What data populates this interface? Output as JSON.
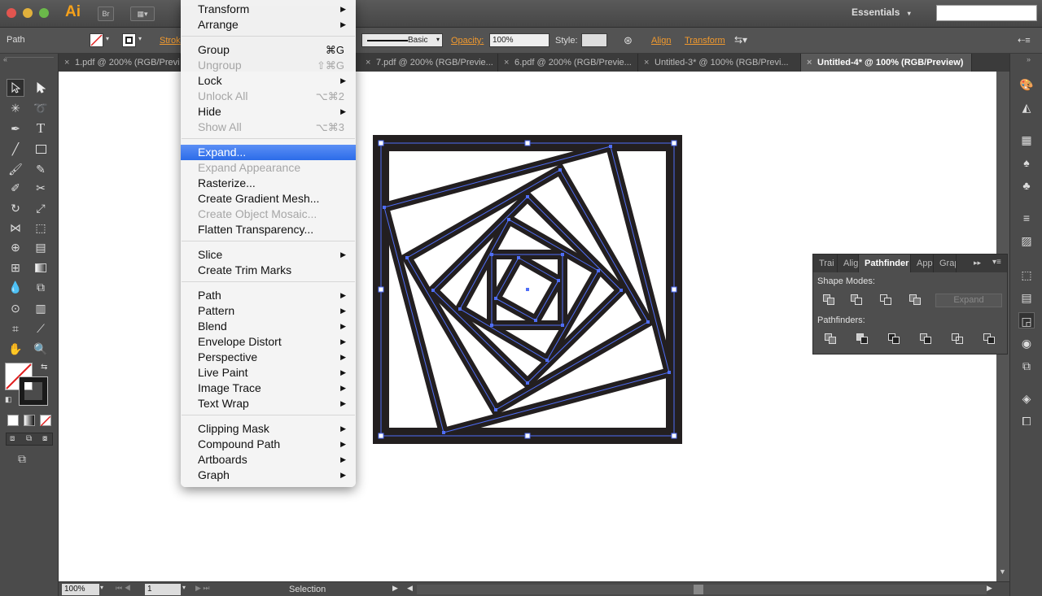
{
  "app": {
    "logo": "Ai",
    "bridge": "Br",
    "workspace": "Essentials"
  },
  "menu": {
    "items": [
      {
        "label": "Transform",
        "submenu": true
      },
      {
        "label": "Arrange",
        "submenu": true
      },
      {
        "label": "Group",
        "shortcut": "⌘G"
      },
      {
        "label": "Ungroup",
        "shortcut": "⇧⌘G",
        "disabled": true
      },
      {
        "label": "Lock",
        "submenu": true
      },
      {
        "label": "Unlock All",
        "shortcut": "⌥⌘2",
        "disabled": true
      },
      {
        "label": "Hide",
        "submenu": true
      },
      {
        "label": "Show All",
        "shortcut": "⌥⌘3",
        "disabled": true
      },
      {
        "label": "Expand...",
        "highlight": true
      },
      {
        "label": "Expand Appearance",
        "disabled": true
      },
      {
        "label": "Rasterize..."
      },
      {
        "label": "Create Gradient Mesh..."
      },
      {
        "label": "Create Object Mosaic...",
        "disabled": true
      },
      {
        "label": "Flatten Transparency..."
      },
      {
        "label": "Slice",
        "submenu": true
      },
      {
        "label": "Create Trim Marks"
      },
      {
        "label": "Path",
        "submenu": true
      },
      {
        "label": "Pattern",
        "submenu": true
      },
      {
        "label": "Blend",
        "submenu": true
      },
      {
        "label": "Envelope Distort",
        "submenu": true
      },
      {
        "label": "Perspective",
        "submenu": true
      },
      {
        "label": "Live Paint",
        "submenu": true
      },
      {
        "label": "Image Trace",
        "submenu": true
      },
      {
        "label": "Text Wrap",
        "submenu": true
      },
      {
        "label": "Clipping Mask",
        "submenu": true
      },
      {
        "label": "Compound Path",
        "submenu": true
      },
      {
        "label": "Artboards",
        "submenu": true
      },
      {
        "label": "Graph",
        "submenu": true
      }
    ]
  },
  "control": {
    "selection_type": "Path",
    "stroke_label": "Strok",
    "brush_preset": "Basic",
    "opacity_label": "Opacity:",
    "opacity_value": "100%",
    "style_label": "Style:",
    "align_label": "Align",
    "transform_label": "Transform"
  },
  "tabs": [
    {
      "label": "1.pdf @ 200% (RGB/Previe..."
    },
    {
      "label": "7.pdf @ 200% (RGB/Previe..."
    },
    {
      "label": "6.pdf @ 200% (RGB/Previe..."
    },
    {
      "label": "Untitled-3* @ 100% (RGB/Previ..."
    },
    {
      "label": "Untitled-4* @ 100% (RGB/Preview)",
      "active": true
    }
  ],
  "pathfinder": {
    "tabs": [
      "Trai",
      "Alig",
      "Pathfinder",
      "App",
      "Grap"
    ],
    "shape_modes_label": "Shape Modes:",
    "pathfinders_label": "Pathfinders:",
    "expand_label": "Expand"
  },
  "status": {
    "zoom": "100%",
    "artboard_number": "1",
    "tool_name": "Selection"
  },
  "colors": {
    "accent_highlight": "#2c6ce9",
    "link_orange": "#f29a2e",
    "selection_blue": "#4f6ef7",
    "artwork_stroke": "#231f20"
  }
}
